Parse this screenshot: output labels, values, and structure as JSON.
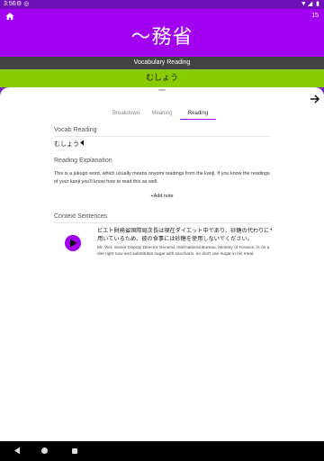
{
  "status_bar": {
    "time": "3:56",
    "left_icons": "⚙ ◎",
    "right_icons": "▼◢ ▮"
  },
  "header": {
    "title": "〜務省",
    "count": "15",
    "background": "#a100f1"
  },
  "question_type": "Vocabulary Reading",
  "answer": "むしょう",
  "tabs": [
    {
      "label": "Breakdown",
      "active": false
    },
    {
      "label": "Meaning",
      "active": false
    },
    {
      "label": "Reading",
      "active": true
    }
  ],
  "vocab_reading": {
    "heading": "Vocab Reading",
    "reading": "むしょう"
  },
  "reading_explanation": {
    "heading": "Reading Explanation",
    "text": "This is a jukugo word, which usually means onyomi readings from the kanji. If you know the readings of your kanji you'll know how to read this as well."
  },
  "add_note_label": "+Add note",
  "context_sentences": {
    "heading": "Context Sentences",
    "ja_line1": "ビエト財務省国際局次長は現在ダイエット中であり、砂糖の代わりにサッカリンを",
    "ja_line2": "用いているため、彼の食事には砂糖を使用しないでください。",
    "en_line1": "Mr. Viet, Senior Deputy Director General, International Bureau, Ministry of Finance, is on a",
    "en_line2": "diet right now and substitutes sugar with saccharin, so don't use sugar in his meal."
  },
  "colors": {
    "accent": "#a100f1",
    "answer_bar": "#88cc00",
    "type_bar": "#434343",
    "page_bg": "#7d1fc8"
  }
}
